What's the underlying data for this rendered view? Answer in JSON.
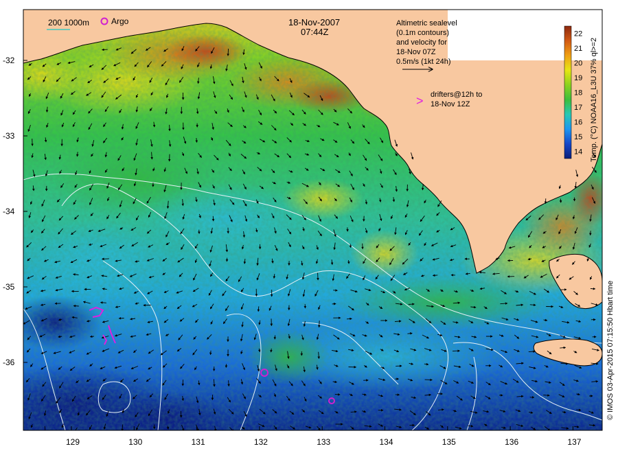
{
  "header": {
    "date": "18-Nov-2007",
    "time": "07:44Z"
  },
  "bathymetry_legend": {
    "label": "200  1000m"
  },
  "argo_legend": {
    "label": "Argo"
  },
  "altimetry_note": {
    "lines": [
      "Altimetric sealevel",
      "(0.1m contours)",
      "and velocity for",
      "18-Nov 07Z",
      "0.5m/s (1kt 24h)"
    ]
  },
  "drifters_note": {
    "symbol": ">",
    "lines": [
      "drifters@12h to",
      "18-Nov 12Z"
    ]
  },
  "colorbar": {
    "title": "Temp. (°C) NOAA16_L3U 37% ql>=2",
    "ticks": [
      "22",
      "21",
      "20",
      "19",
      "18",
      "17",
      "16",
      "15",
      "14"
    ],
    "range": [
      13.5,
      22.5
    ],
    "stops": [
      {
        "v": 13.5,
        "color": "#0a1e78"
      },
      {
        "v": 14.5,
        "color": "#1546c8"
      },
      {
        "v": 15.5,
        "color": "#1e96f0"
      },
      {
        "v": 16.5,
        "color": "#28c8b4"
      },
      {
        "v": 17.5,
        "color": "#3cbe3c"
      },
      {
        "v": 18.5,
        "color": "#8cd21e"
      },
      {
        "v": 19.5,
        "color": "#e6e614"
      },
      {
        "v": 20.5,
        "color": "#f0a014"
      },
      {
        "v": 21.5,
        "color": "#d25a14"
      },
      {
        "v": 22.5,
        "color": "#8c280f"
      }
    ]
  },
  "axes": {
    "lat_ticks": [
      "-32",
      "-33",
      "-34",
      "-35",
      "-36"
    ],
    "lon_ticks": [
      "129",
      "130",
      "131",
      "132",
      "133",
      "134",
      "135",
      "136",
      "137"
    ]
  },
  "credit": "© IMOS 03-Apr-2015 07:15:50 Hbart time",
  "colors": {
    "land": "#f8c8a0",
    "argo": "#d020d0",
    "contour": "#e0ecf4",
    "arrow": "#000000"
  }
}
